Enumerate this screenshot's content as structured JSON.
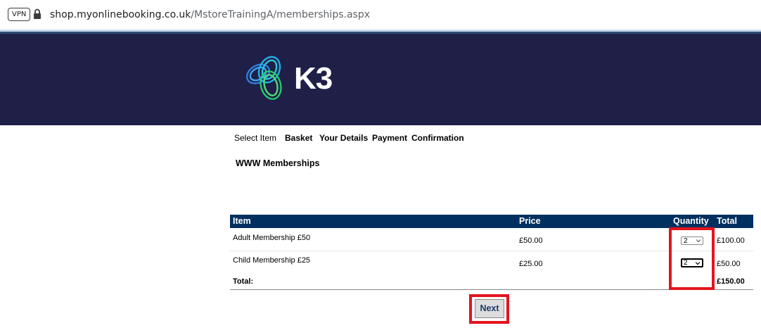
{
  "browser": {
    "vpn_label": "VPN",
    "url_host": "shop.myonlinebooking.co.uk",
    "url_path": "/MstoreTrainingA/memberships.aspx"
  },
  "brand": {
    "logo_text": "K3"
  },
  "steps": [
    "Select Item",
    "Basket",
    "Your Details",
    "Payment",
    "Confirmation"
  ],
  "page_heading": "WWW Memberships",
  "table": {
    "headers": {
      "item": "Item",
      "price": "Price",
      "quantity": "Quantity",
      "total": "Total"
    },
    "rows": [
      {
        "item": "Adult Membership £50",
        "price": "£50.00",
        "quantity": "2",
        "total": "£100.00"
      },
      {
        "item": "Child Membership £25",
        "price": "£25.00",
        "quantity": "2",
        "total": "£50.00"
      }
    ],
    "total_label": "Total:",
    "grand_total": "£150.00"
  },
  "next_label": "Next",
  "colors": {
    "banner": "#1f1f47",
    "table_header": "#003060",
    "highlight": "#e3141e"
  }
}
